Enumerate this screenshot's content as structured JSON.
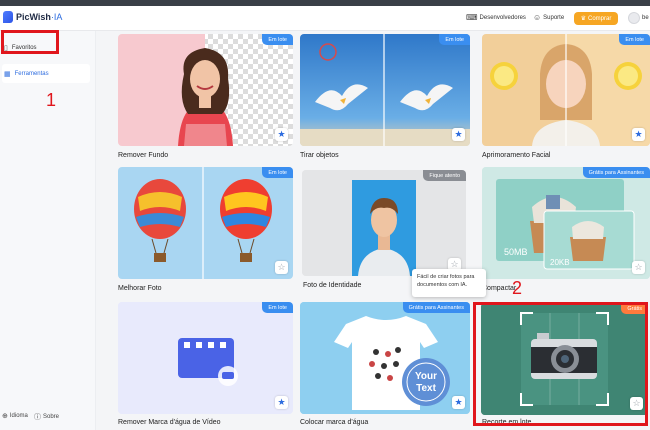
{
  "header": {
    "app_name": "PicWish",
    "app_suffix": "·IA",
    "developers_label": "Desenvolvedores",
    "support_label": "Suporte",
    "buy_label": "Comprar",
    "user_label": "be"
  },
  "sidebar": {
    "items": [
      {
        "label": "Favoritos",
        "icon": "bookmark-icon"
      },
      {
        "label": "Ferramentas",
        "icon": "grid-icon"
      }
    ],
    "bottom": {
      "language_label": "Idioma",
      "about_label": "Sobre"
    }
  },
  "annotations": {
    "first": "1",
    "second": "2"
  },
  "tools": [
    {
      "label": "Remover Fundo",
      "badge": "Em lote",
      "favorited": true
    },
    {
      "label": "Tirar objetos",
      "badge": "Em lote",
      "favorited": true
    },
    {
      "label": "Aprimoramento Facial",
      "badge": "Em lote",
      "favorited": true
    },
    {
      "label": "Melhorar Foto",
      "badge": "Em lote",
      "favorited": false
    },
    {
      "label": "Foto de Identidade",
      "badge": "Fique atento",
      "favorited": false
    },
    {
      "label": "Compactar",
      "badge": "Grátis para Assinantes",
      "favorited": false,
      "sizes": [
        "50MB",
        "20KB"
      ]
    },
    {
      "label": "Remover Marca d'água de Vídeo",
      "badge": "Em lote",
      "favorited": true
    },
    {
      "label": "Colocar marca d'água",
      "badge": "Grátis para Assinantes",
      "favorited": true,
      "stamp_lines": [
        "Your",
        "Text"
      ]
    },
    {
      "label": "Recorte em lote",
      "badge": "Grátis",
      "favorited": false
    }
  ],
  "tooltip": {
    "text": "Fácil de criar fotos para documentos com IA."
  },
  "colors": {
    "accent": "#2d6cdf",
    "badge_blue": "#3a8ef0",
    "buy_orange": "#f6a623",
    "annotation_red": "#e0161c"
  }
}
